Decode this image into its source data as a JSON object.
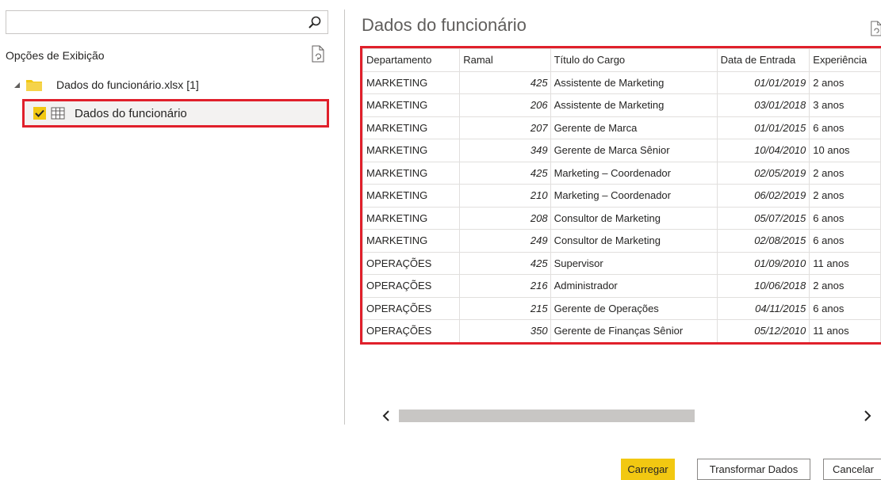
{
  "left_pane": {
    "search": {
      "value": "",
      "placeholder": ""
    },
    "view_options_label": "Opções de Exibição",
    "file_label": "Dados do funcionário.xlsx [1]",
    "selected_item_label": "Dados do funcionário"
  },
  "preview": {
    "title": "Dados do funcionário",
    "columns": [
      "Departamento",
      "Ramal",
      "Título do Cargo",
      "Data de Entrada",
      "Experiência"
    ],
    "rows": [
      [
        "MARKETING",
        "425",
        "Assistente de Marketing",
        "01/01/2019",
        "2 anos"
      ],
      [
        "MARKETING",
        "206",
        "Assistente de Marketing",
        "03/01/2018",
        "3 anos"
      ],
      [
        "MARKETING",
        "207",
        "Gerente de Marca",
        "01/01/2015",
        "6 anos"
      ],
      [
        "MARKETING",
        "349",
        "Gerente de Marca Sênior",
        "10/04/2010",
        "10 anos"
      ],
      [
        "MARKETING",
        "425",
        "Marketing – Coordenador",
        "02/05/2019",
        "2 anos"
      ],
      [
        "MARKETING",
        "210",
        "Marketing – Coordenador",
        "06/02/2019",
        "2 anos"
      ],
      [
        "MARKETING",
        "208",
        "Consultor de Marketing",
        "05/07/2015",
        "6 anos"
      ],
      [
        "MARKETING",
        "249",
        "Consultor de Marketing",
        "02/08/2015",
        "6 anos"
      ],
      [
        "OPERAÇÕES",
        "425",
        "Supervisor",
        "01/09/2010",
        "11 anos"
      ],
      [
        "OPERAÇÕES",
        "216",
        "Administrador",
        "10/06/2018",
        "2 anos"
      ],
      [
        "OPERAÇÕES",
        "215",
        "Gerente de Operações",
        "04/11/2015",
        "6 anos"
      ],
      [
        "OPERAÇÕES",
        "350",
        "Gerente de Finanças Sênior",
        "05/12/2010",
        "11 anos"
      ]
    ]
  },
  "footer": {
    "load_label": "Carregar",
    "transform_label": "Transformar Dados",
    "cancel_label": "Cancelar"
  },
  "colors": {
    "accent": "#f2c811",
    "highlight_border": "#e0202b"
  },
  "icons": [
    "search-icon",
    "refresh-icon",
    "folder-icon",
    "checkbox-checked-icon",
    "table-icon",
    "chevron-left-icon",
    "chevron-right-icon"
  ]
}
